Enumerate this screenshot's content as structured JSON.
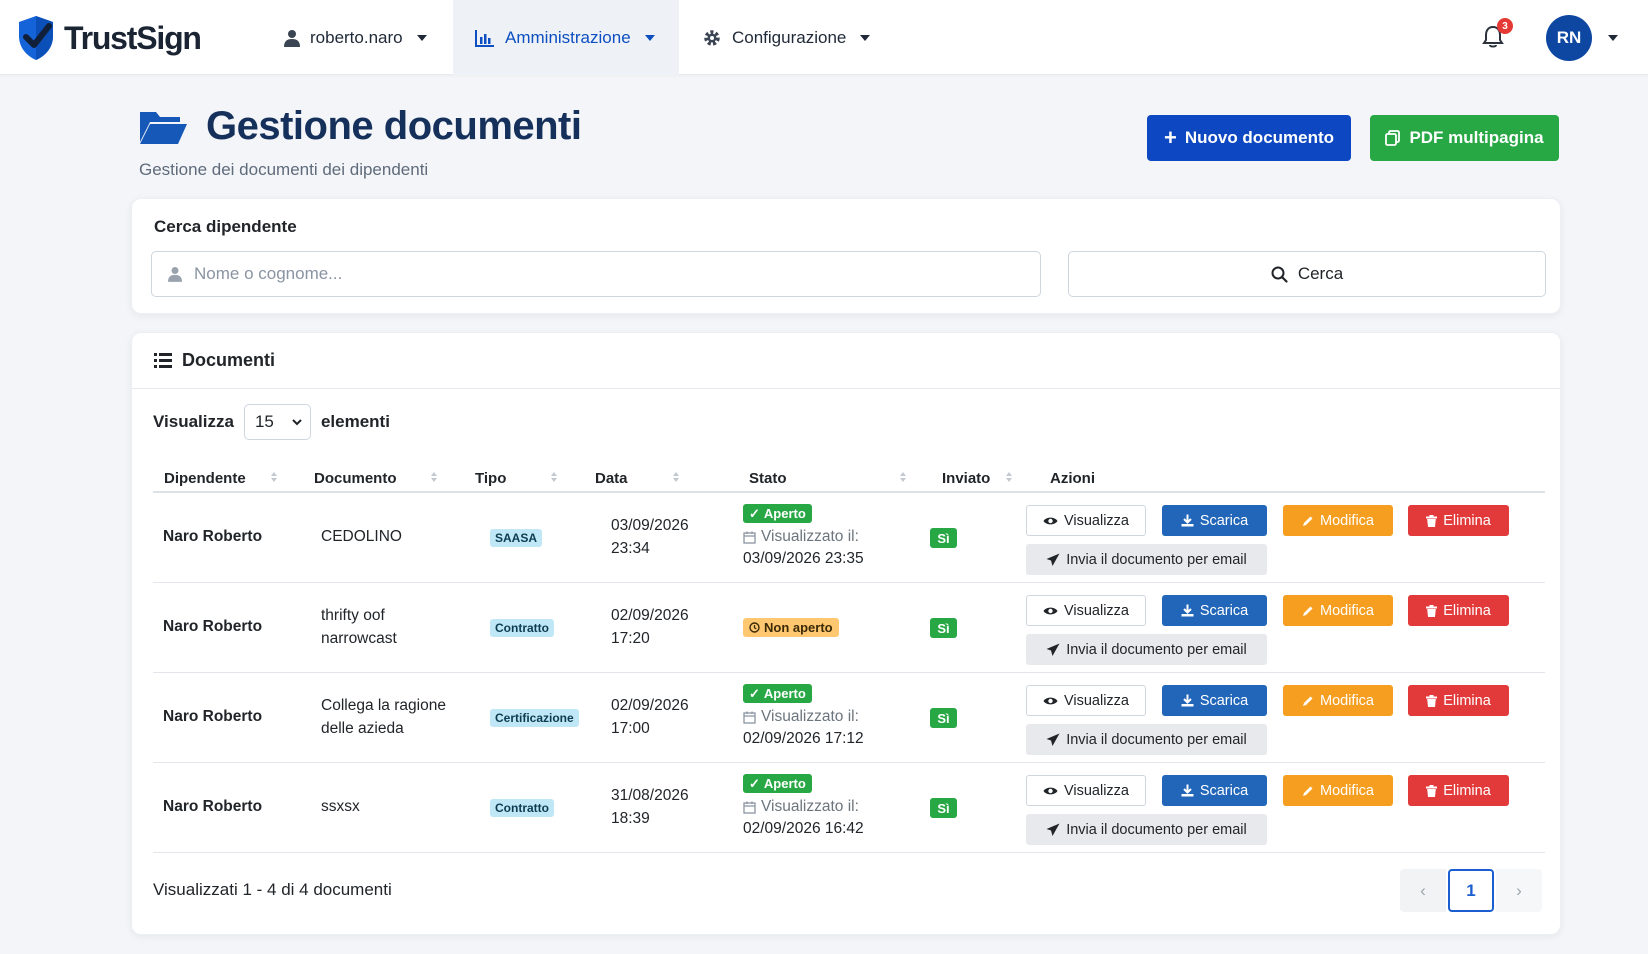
{
  "app": {
    "name": "TrustSign"
  },
  "nav": {
    "user": "roberto.naro",
    "admin": "Amministrazione",
    "config": "Configurazione",
    "notifications_count": "3",
    "avatar_initials": "RN"
  },
  "header": {
    "title": "Gestione documenti",
    "subtitle": "Gestione dei documenti dei dipendenti",
    "new_doc_label": "Nuovo documento",
    "pdf_label": "PDF multipagina"
  },
  "search": {
    "label": "Cerca dipendente",
    "placeholder": "Nome o cognome...",
    "value": "",
    "button_label": "Cerca"
  },
  "documents": {
    "title": "Documenti",
    "show_label": "Visualizza",
    "page_size": "15",
    "elements_label": "elementi",
    "columns": [
      "Dipendente",
      "Documento",
      "Tipo",
      "Data",
      "Stato",
      "Inviato",
      "Azioni"
    ],
    "rows": [
      {
        "employee": "Naro Roberto",
        "doc_line1": "CEDOLINO",
        "doc_line2": "",
        "type": "SAASA",
        "date": "03/09/2026",
        "time": "23:34",
        "status": "Aperto",
        "viewed_label": "Visualizzato il:",
        "viewed_at": "03/09/2026 23:35",
        "sent": "Sì"
      },
      {
        "employee": "Naro Roberto",
        "doc_line1": "thrifty oof",
        "doc_line2": "narrowcast",
        "type": "Contratto",
        "date": "02/09/2026",
        "time": "17:20",
        "status": "Non aperto",
        "viewed_label": "",
        "viewed_at": "",
        "sent": "Sì"
      },
      {
        "employee": "Naro Roberto",
        "doc_line1": "Collega la ragione",
        "doc_line2": "delle azieda",
        "type": "Certificazione",
        "date": "02/09/2026",
        "time": "17:00",
        "status": "Aperto",
        "viewed_label": "Visualizzato il:",
        "viewed_at": "02/09/2026 17:12",
        "sent": "Sì"
      },
      {
        "employee": "Naro Roberto",
        "doc_line1": "ssxsx",
        "doc_line2": "",
        "type": "Contratto",
        "date": "31/08/2026",
        "time": "18:39",
        "status": "Aperto",
        "viewed_label": "Visualizzato il:",
        "viewed_at": "02/09/2026 16:42",
        "sent": "Sì"
      }
    ],
    "actions": {
      "view": "Visualizza",
      "download": "Scarica",
      "edit": "Modifica",
      "delete": "Elimina",
      "email": "Invia il documento per email"
    },
    "info": "Visualizzati 1 - 4 di 4 documenti",
    "pagination": {
      "prev": "‹",
      "current": "1",
      "next": "›"
    }
  },
  "colors": {
    "brand_blue": "#0d47c1",
    "success_green": "#28a745",
    "warning_orange": "#f59e1f",
    "danger_red": "#e23a3a",
    "title_navy": "#15305a"
  }
}
